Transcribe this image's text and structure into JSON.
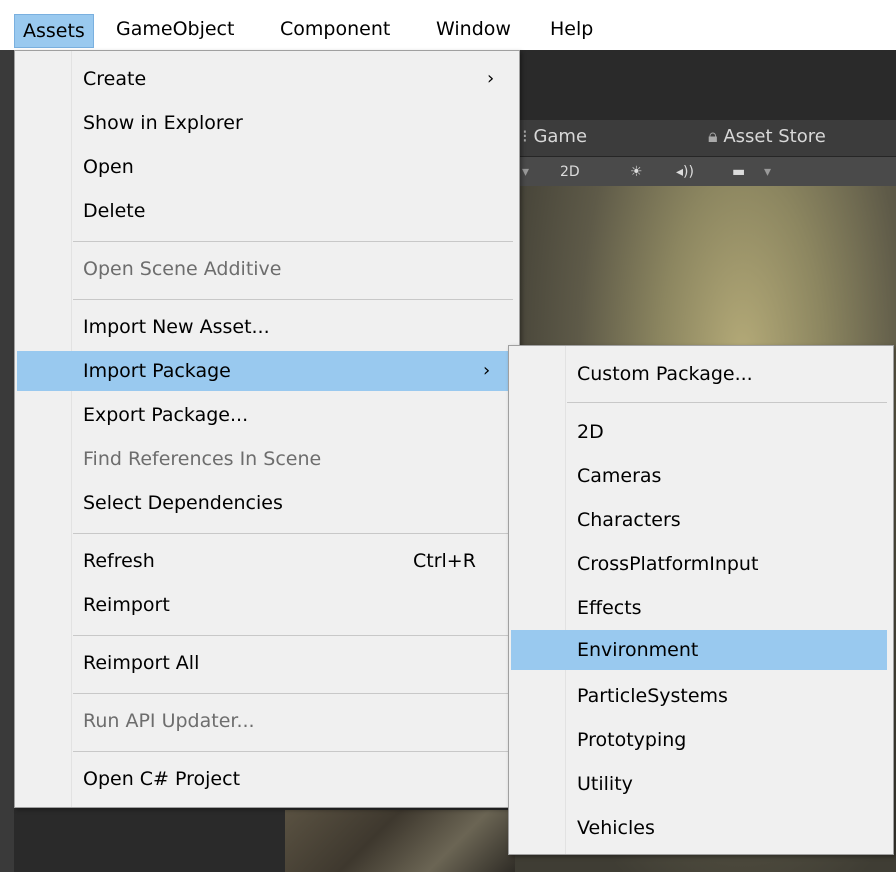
{
  "menubar": [
    {
      "label": "Assets",
      "active": true
    },
    {
      "label": "GameObject"
    },
    {
      "label": "Component"
    },
    {
      "label": "Window"
    },
    {
      "label": "Help"
    }
  ],
  "editor": {
    "tab_game": "Game",
    "tab_store": "Asset Store",
    "tb_2d": "2D",
    "tb_sun": "☀",
    "tb_audio": "◂))",
    "tb_img": "▬"
  },
  "assets_menu": [
    {
      "label": "Create",
      "arrow": "›"
    },
    {
      "label": "Show in Explorer"
    },
    {
      "label": "Open"
    },
    {
      "label": "Delete"
    },
    {
      "label": "Open Scene Additive",
      "disabled": true
    },
    {
      "label": "Import New Asset..."
    },
    {
      "label": "Import Package",
      "arrow": "›",
      "highlighted": true
    },
    {
      "label": "Export Package..."
    },
    {
      "label": "Find References In Scene",
      "disabled": true
    },
    {
      "label": "Select Dependencies"
    },
    {
      "label": "Refresh",
      "shortcut": "Ctrl+R"
    },
    {
      "label": "Reimport"
    },
    {
      "label": "Reimport All"
    },
    {
      "label": "Run API Updater...",
      "disabled": true
    },
    {
      "label": "Open C# Project"
    }
  ],
  "import_package_menu": [
    {
      "label": "Custom Package..."
    },
    {
      "label": "2D"
    },
    {
      "label": "Cameras"
    },
    {
      "label": "Characters"
    },
    {
      "label": "CrossPlatformInput"
    },
    {
      "label": "Effects"
    },
    {
      "label": "Environment",
      "highlighted": true
    },
    {
      "label": "ParticleSystems"
    },
    {
      "label": "Prototyping"
    },
    {
      "label": "Utility"
    },
    {
      "label": "Vehicles"
    }
  ],
  "colors": {
    "highlight": "#99c9ef",
    "menu_bg": "#f0f0f0",
    "editor_bg": "#2a2a2a"
  }
}
